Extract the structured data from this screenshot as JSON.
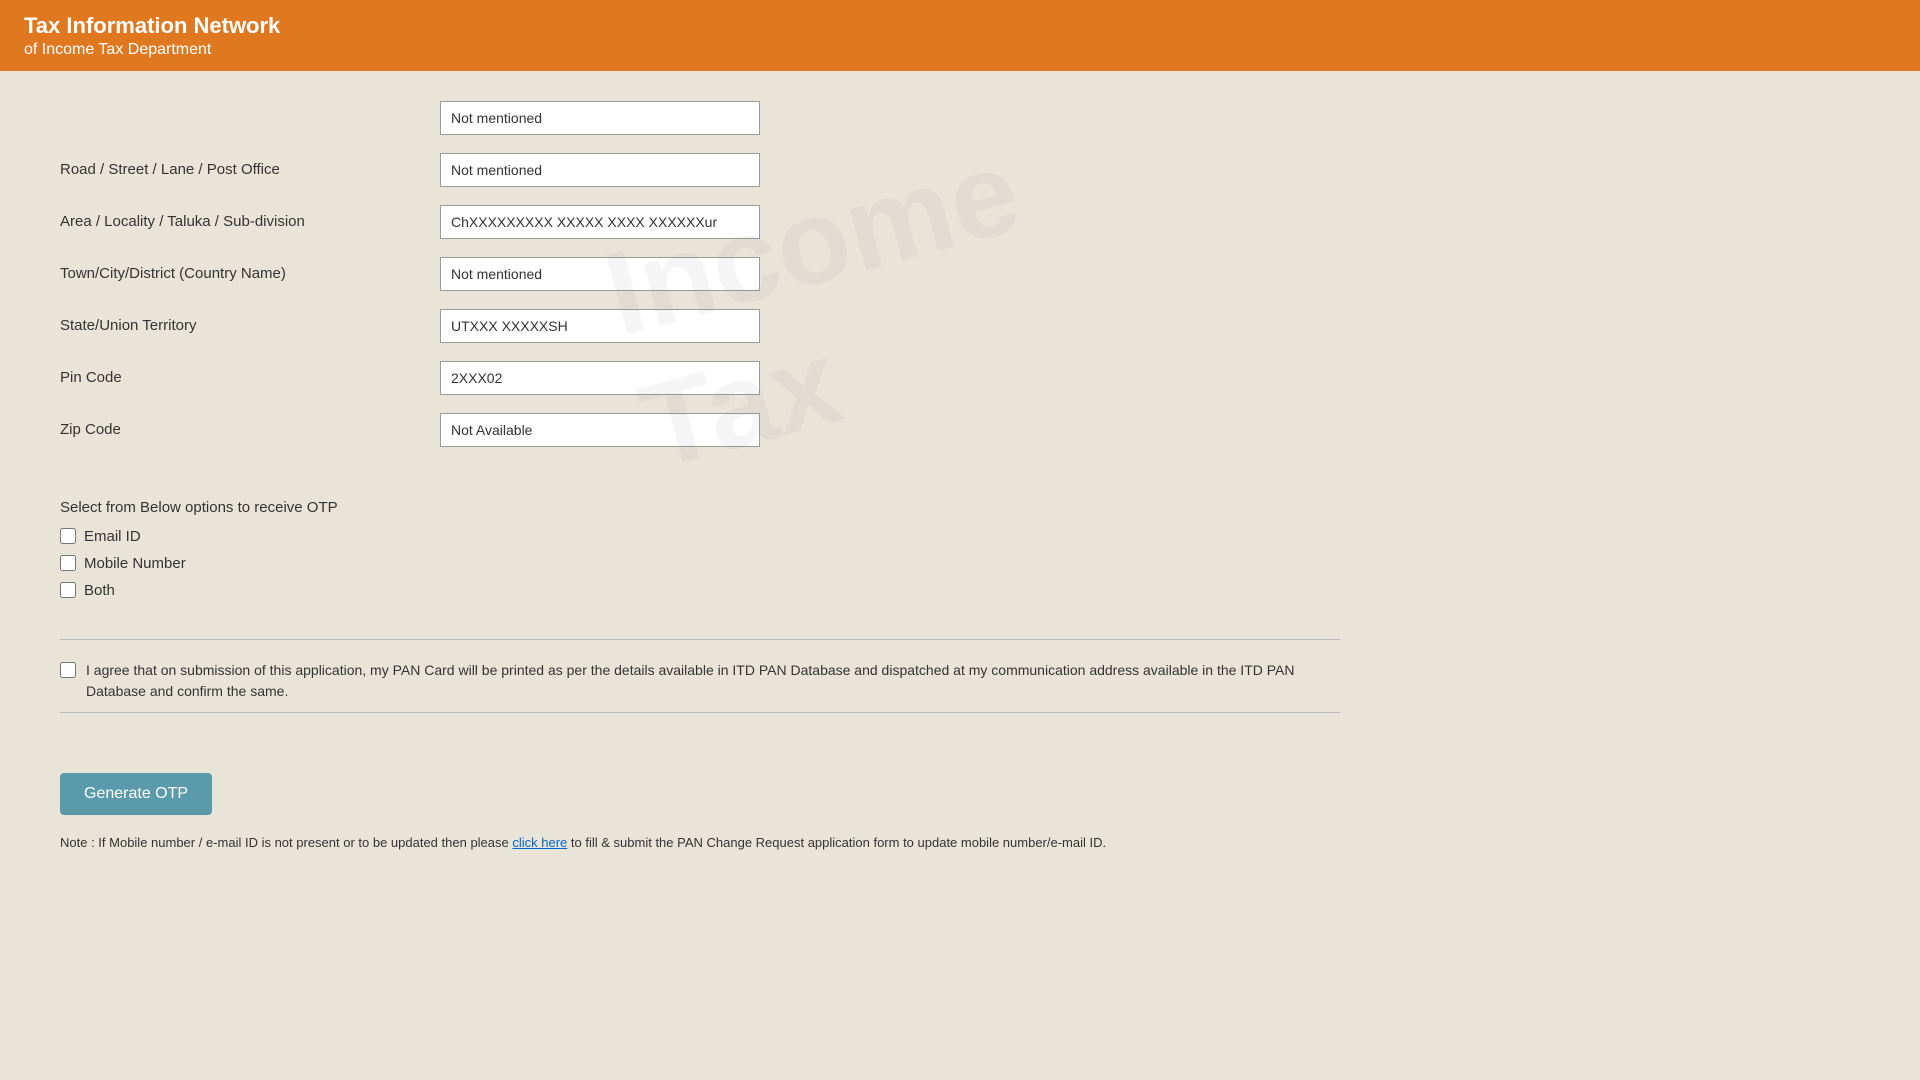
{
  "header": {
    "title": "Tax Information Network",
    "subtitle": "of Income Tax Department"
  },
  "form": {
    "fields": [
      {
        "id": "building-name",
        "label": "",
        "value": "Not mentioned"
      },
      {
        "id": "road-street",
        "label": "Road / Street / Lane / Post Office",
        "value": "Not mentioned"
      },
      {
        "id": "area-locality",
        "label": "Area / Locality / Taluka / Sub-division",
        "value": "ChXXXXXXXXX XXXXX XXXX XXXXXXur"
      },
      {
        "id": "town-city",
        "label": "Town/City/District (Country Name)",
        "value": "Not mentioned"
      },
      {
        "id": "state-union",
        "label": "State/Union Territory",
        "value": "UTXXX XXXXXSH"
      },
      {
        "id": "pin-code",
        "label": "Pin Code",
        "value": "2XXX02"
      },
      {
        "id": "zip-code",
        "label": "Zip Code",
        "value": "Not Available"
      }
    ]
  },
  "otp_section": {
    "title": "Select from Below options to receive OTP",
    "options": [
      {
        "id": "email-id",
        "label": "Email ID"
      },
      {
        "id": "mobile-number",
        "label": "Mobile Number"
      },
      {
        "id": "both",
        "label": "Both"
      }
    ]
  },
  "agreement": {
    "text": "I agree that on submission of this application, my PAN Card will be printed as per the details available in ITD PAN Database and dispatched at my communication address available in the ITD PAN Database and confirm the same."
  },
  "buttons": {
    "generate_otp": "Generate OTP"
  },
  "note": {
    "prefix": "Note : If Mobile number / e-mail ID is not present or to be updated then please",
    "link_text": "click here",
    "suffix": "to fill & submit the PAN Change Request application form to update mobile number/e-mail ID."
  },
  "watermark": {
    "line1": "Income",
    "line2": "Tax"
  }
}
